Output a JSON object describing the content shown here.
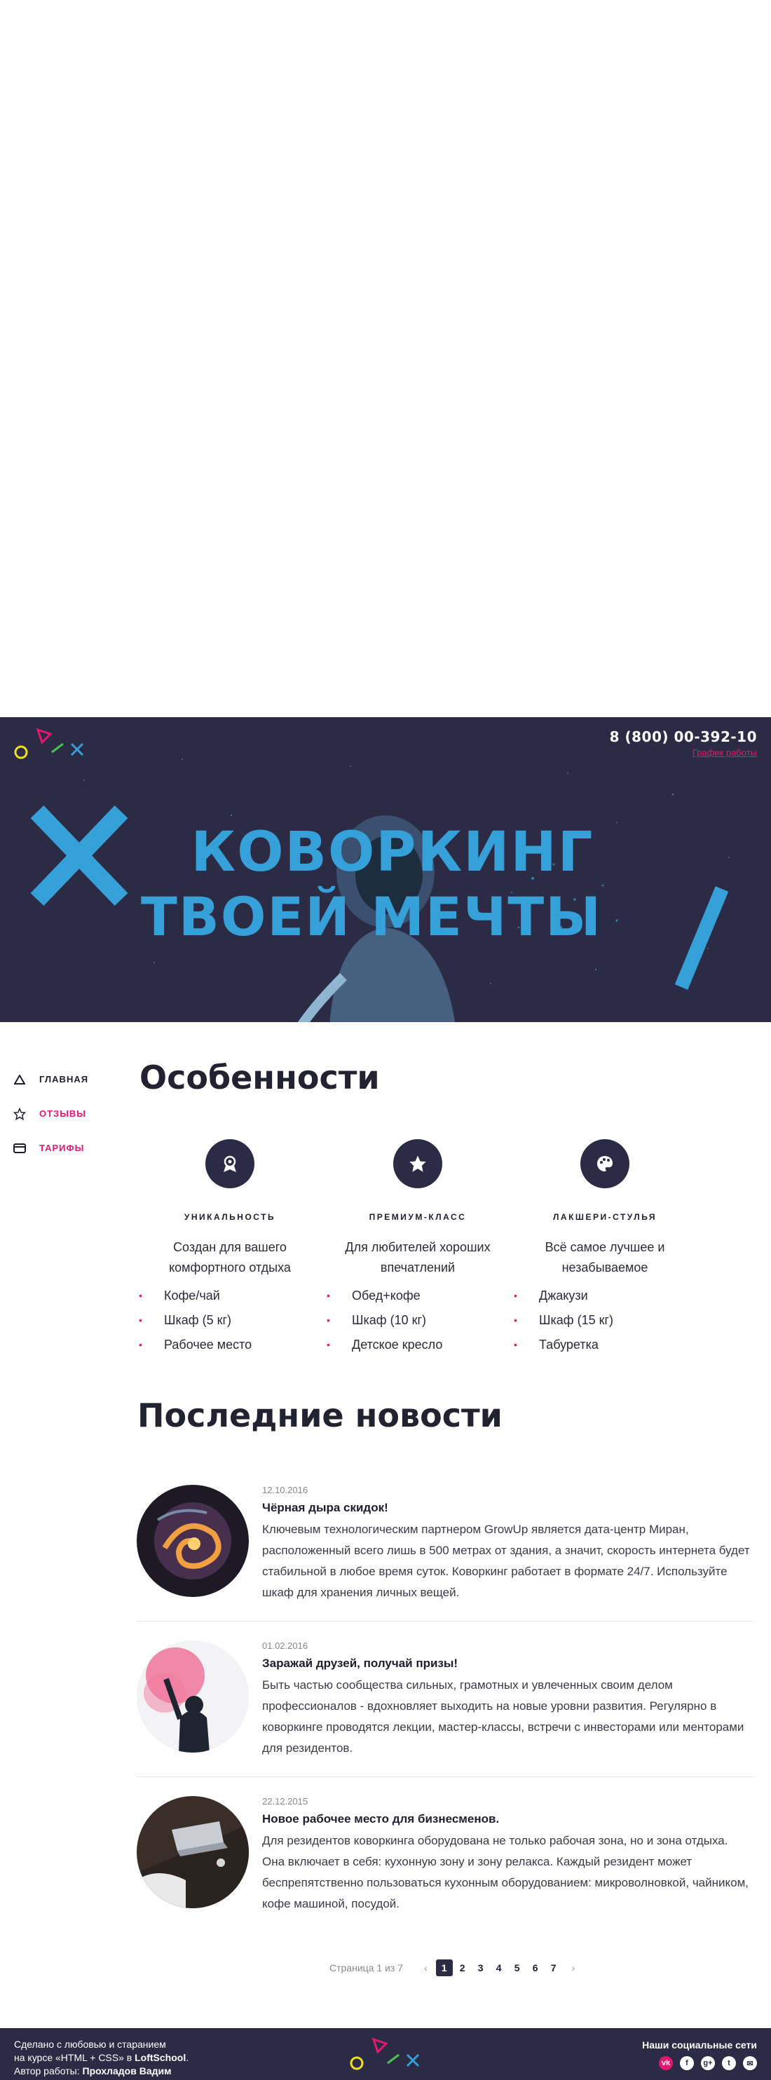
{
  "header": {
    "phone": "8 (800) 00-392-10",
    "schedule_link": "График работы",
    "hero_line1": "КОВОРКИНГ",
    "hero_line2": "ТВОЕЙ МЕЧТЫ"
  },
  "sidebar": {
    "items": [
      {
        "label": "ГЛАВНАЯ",
        "icon": "triangle-icon"
      },
      {
        "label": "ОТЗЫВЫ",
        "icon": "star-icon"
      },
      {
        "label": "ТАРИФЫ",
        "icon": "wallet-icon"
      }
    ]
  },
  "features": {
    "title": "Особенности",
    "items": [
      {
        "icon": "medal-icon",
        "title": "УНИКАЛЬНОСТЬ",
        "desc": "Создан для вашего комфортного отдыха",
        "list": [
          "Кофе/чай",
          "Шкаф (5 кг)",
          "Рабочее место"
        ]
      },
      {
        "icon": "star-icon",
        "title": "ПРЕМИУМ-КЛАСС",
        "desc": "Для любителей хороших впечатлений",
        "list": [
          "Обед+кофе",
          "Шкаф (10 кг)",
          "Детское кресло"
        ]
      },
      {
        "icon": "palette-icon",
        "title": "ЛАКШЕРИ-СТУЛЬЯ",
        "desc": "Всё самое лучшее и незабываемое",
        "list": [
          "Джакузи",
          "Шкаф (15 кг)",
          "Табуретка"
        ]
      }
    ]
  },
  "news": {
    "title": "Последние новости",
    "items": [
      {
        "date": "12.10.2016",
        "title": "Чёрная дыра скидок!",
        "text": "Ключевым технологическим партнером GrowUp является дата-центр Миран, расположенный всего лишь в 500 метрах от здания, а значит, скорость интернета будет стабильной в любое время суток. Коворкинг работает в формате 24/7. Используйте шкаф для хранения личных вещей."
      },
      {
        "date": "01.02.2016",
        "title": "Заражай друзей, получай призы!",
        "text": "Быть частью сообщества сильных, грамотных и увлеченных своим делом профессионалов - вдохновляет выходить на новые уровни развития. Регулярно в коворкинге проводятся лекции, мастер-классы, встречи с инвесторами или менторами для резидентов."
      },
      {
        "date": "22.12.2015",
        "title": "Новое рабочее место для бизнесменов.",
        "text": "Для резидентов коворкинга оборудована не только рабочая зона, но и зона отдыха. Она включает в себя: кухонную зону и зону релакса. Каждый резидент может беспрепятственно пользоваться кухонным оборудованием: микроволновкой, чайником, кофе машиной, посудой."
      }
    ]
  },
  "pagination": {
    "label": "Страница 1 из 7",
    "prev": "‹",
    "next": "›",
    "pages": [
      "1",
      "2",
      "3",
      "4",
      "5",
      "6",
      "7"
    ],
    "current": "1"
  },
  "footer": {
    "line1": "Сделано с любовью и старанием",
    "line2_prefix": "на курсе «HTML + CSS» в ",
    "line2_brand": "LoftSchool",
    "line2_suffix": ".",
    "line3_prefix": "Автор работы: ",
    "line3_author": "Прохладов Вадим",
    "social_title": "Наши социальные сети",
    "social": [
      "vk-icon",
      "facebook-icon",
      "google-plus-icon",
      "twitter-icon",
      "mail-icon"
    ]
  },
  "colors": {
    "navy": "#2b2b45",
    "accent_pink": "#e5176f",
    "hero_blue": "#36a1d8"
  }
}
